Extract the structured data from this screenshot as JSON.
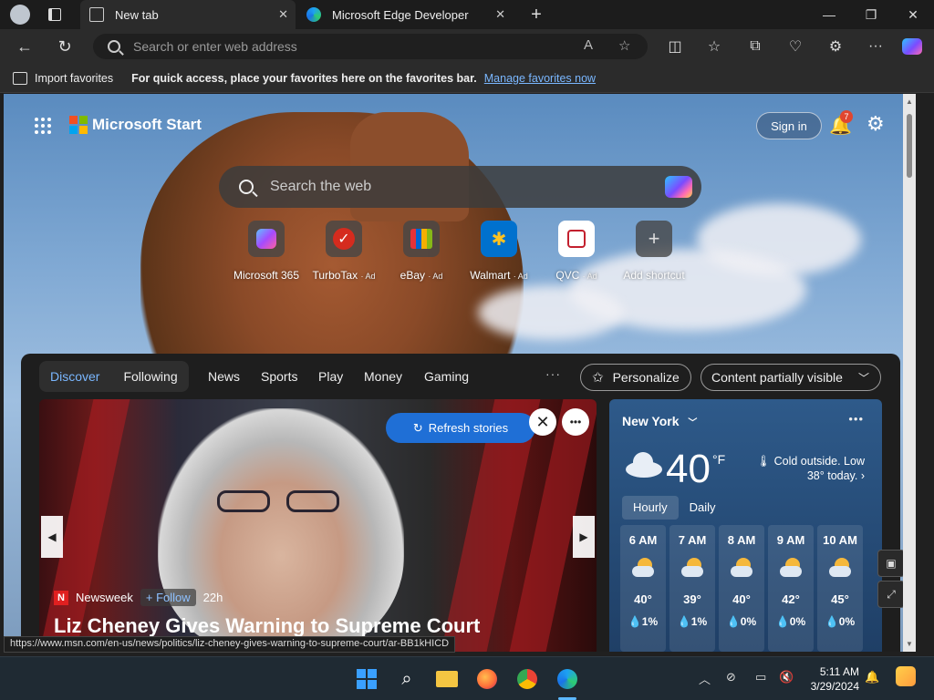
{
  "browser": {
    "tabs": [
      {
        "label": "New tab",
        "active": true
      },
      {
        "label": "Microsoft Edge Developer",
        "active": false
      }
    ],
    "address_placeholder": "Search or enter web address",
    "favorites_bar": {
      "import_label": "Import favorites",
      "message": "For quick access, place your favorites here on the favorites bar.",
      "link": "Manage favorites now"
    }
  },
  "start": {
    "brand": "Microsoft Start",
    "sign_in": "Sign in",
    "notification_count": "7",
    "search_placeholder": "Search the web",
    "shortcuts": [
      {
        "label": "Microsoft 365",
        "ad": ""
      },
      {
        "label": "TurboTax",
        "ad": "· Ad"
      },
      {
        "label": "eBay",
        "ad": "· Ad"
      },
      {
        "label": "Walmart",
        "ad": "· Ad"
      },
      {
        "label": "QVC",
        "ad": "· Ad"
      },
      {
        "label": "Add shortcut",
        "ad": ""
      }
    ]
  },
  "feed": {
    "pills": [
      "Discover",
      "Following"
    ],
    "nav": [
      "News",
      "Sports",
      "Play",
      "Money",
      "Gaming"
    ],
    "more": "···",
    "personalize": "Personalize",
    "content_visibility": "Content partially visible",
    "refresh": "Refresh stories",
    "hero": {
      "source": "Newsweek",
      "follow": "+ Follow",
      "time": "22h",
      "headline": "Liz Cheney Gives Warning to Supreme Court"
    }
  },
  "weather": {
    "city": "New York",
    "temp": "40",
    "unit": "°F",
    "desc": "Cold outside. Low 38° today.",
    "tabs": [
      "Hourly",
      "Daily"
    ],
    "hours": [
      {
        "time": "6 AM",
        "temp": "40°",
        "precip": "💧1%"
      },
      {
        "time": "7 AM",
        "temp": "39°",
        "precip": "💧1%"
      },
      {
        "time": "8 AM",
        "temp": "40°",
        "precip": "💧0%"
      },
      {
        "time": "9 AM",
        "temp": "42°",
        "precip": "💧0%"
      },
      {
        "time": "10 AM",
        "temp": "45°",
        "precip": "💧0%"
      }
    ]
  },
  "status_url": "https://www.msn.com/en-us/news/politics/liz-cheney-gives-warning-to-supreme-court/ar-BB1kHICD",
  "taskbar": {
    "time": "5:11 AM",
    "date": "3/29/2024"
  },
  "colors": {
    "accent": "#1f6fd6",
    "link": "#7ab7ff",
    "notification": "#e0462f"
  }
}
